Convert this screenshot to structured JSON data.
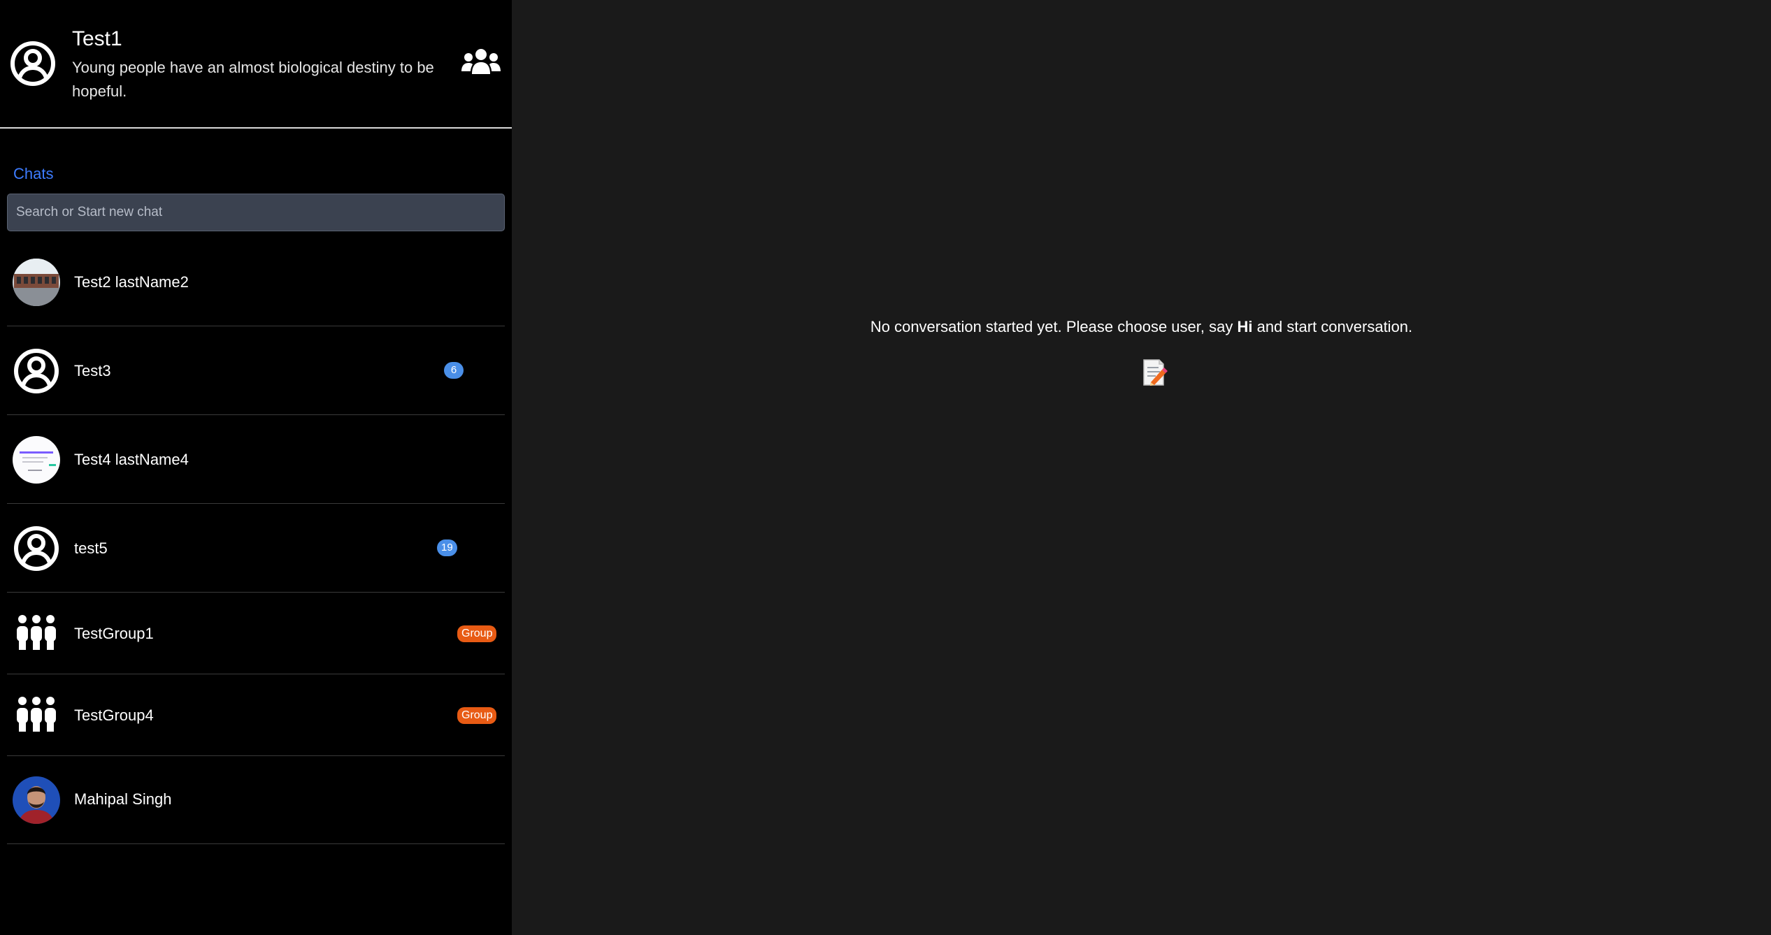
{
  "profile": {
    "name": "Test1",
    "status": "Young people have an almost biological destiny to be hopeful.",
    "group_icon": "users-icon"
  },
  "chats_label": "Chats",
  "search": {
    "placeholder": "Search or Start new chat",
    "value": ""
  },
  "chats": [
    {
      "name": "Test2 lastName2",
      "avatar": "photo-building",
      "badge": ""
    },
    {
      "name": "Test3",
      "avatar": "user-circle-icon",
      "badge": "6"
    },
    {
      "name": "Test4 lastName4",
      "avatar": "photo-screenshot",
      "badge": ""
    },
    {
      "name": "test5",
      "avatar": "user-circle-icon",
      "badge": "19"
    },
    {
      "name": "TestGroup1",
      "avatar": "group-icon",
      "badge": "Group"
    },
    {
      "name": "TestGroup4",
      "avatar": "group-icon",
      "badge": "Group"
    },
    {
      "name": "Mahipal Singh",
      "avatar": "photo-person",
      "badge": ""
    }
  ],
  "main": {
    "empty_prefix": "No conversation started yet. Please choose user, say ",
    "empty_bold": "Hi",
    "empty_suffix": " and start conversation.",
    "icon": "memo-icon"
  },
  "colors": {
    "sidebar_bg": "#000000",
    "main_bg": "#1a1a1a",
    "accent": "#3d7cff",
    "count_badge": "#4a8fe8",
    "group_badge": "#e85b14"
  }
}
